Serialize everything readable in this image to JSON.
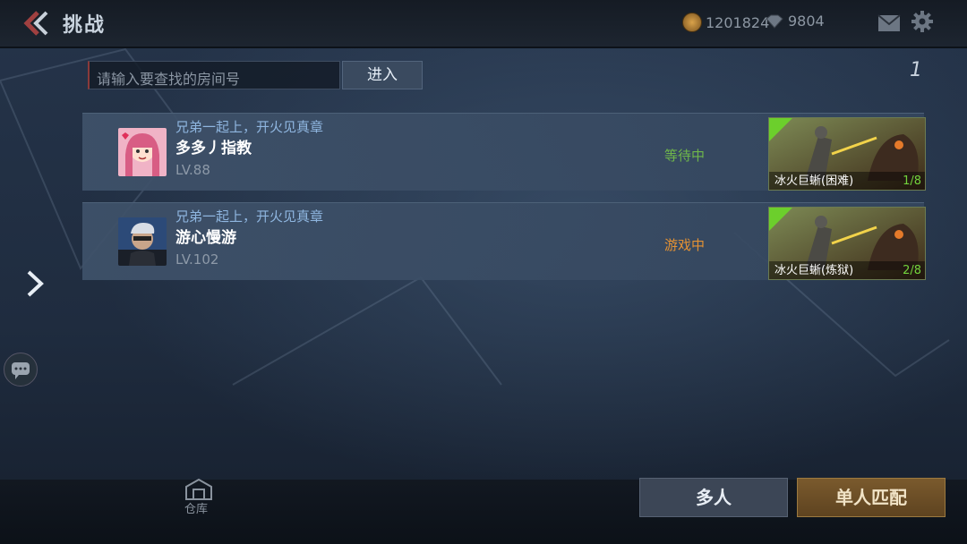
{
  "header": {
    "title": "挑战",
    "gold": "1201824",
    "diamond": "9804"
  },
  "search": {
    "placeholder": "请输入要查找的房间号",
    "enter_label": "进入",
    "page": "1"
  },
  "rooms": [
    {
      "motto": "兄弟一起上，开火见真章",
      "name": "多多丿指教",
      "level": "LV.88",
      "status": "等待中",
      "map_name": "冰火巨蜥(困难)",
      "count": "1/8",
      "avatar_color": "#d86a8a"
    },
    {
      "motto": "兄弟一起上，开火见真章",
      "name": "游心慢游",
      "level": "LV.102",
      "status": "游戏中",
      "map_name": "冰火巨蜥(炼狱)",
      "count": "2/8",
      "avatar_color": "#4a6a9a"
    }
  ],
  "footer": {
    "warehouse_label": "仓库",
    "multi_label": "多人",
    "match_label": "单人匹配"
  },
  "colors": {
    "status_waiting": "#6fb74a",
    "status_playing": "#e59233",
    "accent_green": "#6ccf2c"
  }
}
